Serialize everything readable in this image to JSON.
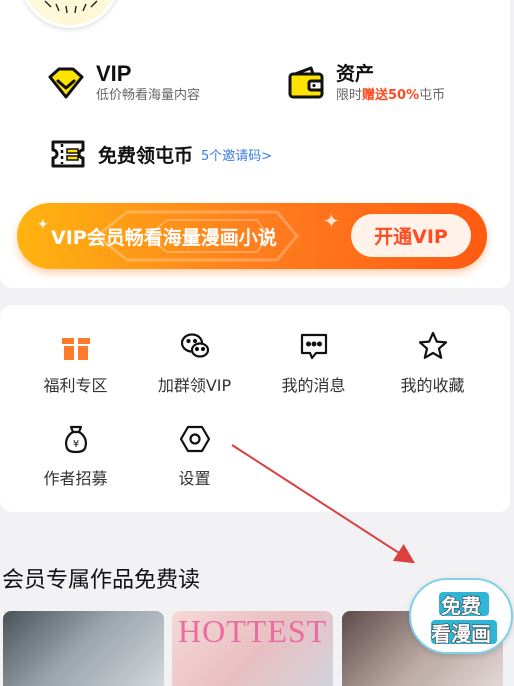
{
  "vip_row": {
    "title": "VIP",
    "subtitle": "低价畅看海量内容"
  },
  "asset_row": {
    "title": "资产",
    "subtitle_prefix": "限时",
    "subtitle_highlight": "赠送50%",
    "subtitle_suffix": "屯币"
  },
  "coin_row": {
    "title": "免费领屯币",
    "invite": "5个邀请码>"
  },
  "banner": {
    "text": "VIP会员畅看海量漫画小说",
    "button": "开通VIP"
  },
  "menu": [
    {
      "label": "福利专区",
      "icon": "gift-icon"
    },
    {
      "label": "加群领VIP",
      "icon": "wechat-icon"
    },
    {
      "label": "我的消息",
      "icon": "message-icon"
    },
    {
      "label": "我的收藏",
      "icon": "star-icon"
    },
    {
      "label": "作者招募",
      "icon": "money-bag-icon"
    },
    {
      "label": "设置",
      "icon": "settings-icon"
    }
  ],
  "section": {
    "title": "会员专属作品免费读"
  },
  "thumbs": [
    {
      "text": ""
    },
    {
      "text": "HOTTEST"
    },
    {
      "text": ""
    }
  ],
  "float_button": {
    "line1": "免费",
    "line2": "看漫画"
  },
  "colors": {
    "accent": "#ff4b1f",
    "link": "#3a7be8",
    "banner_start": "#ffb410",
    "banner_end": "#ff5a12",
    "annotation_arrow": "#d94040"
  }
}
